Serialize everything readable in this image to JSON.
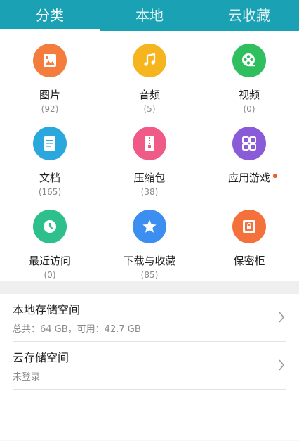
{
  "tabs": [
    {
      "label": "分类"
    },
    {
      "label": "本地"
    },
    {
      "label": "云收藏"
    }
  ],
  "colors": {
    "tabbar": "#1aa1b4",
    "image": "#f47c3c",
    "music": "#f6b51e",
    "video": "#2fbf5f",
    "document": "#2aa8de",
    "archive": "#ef5b86",
    "apps": "#8a5bd8",
    "recent": "#2dbf8c",
    "download": "#3c8ef0",
    "safe": "#f4713c"
  },
  "categories": [
    {
      "name": "图片",
      "count": "(92)",
      "icon": "image-icon"
    },
    {
      "name": "音频",
      "count": "(5)",
      "icon": "music-icon"
    },
    {
      "name": "视频",
      "count": "(0)",
      "icon": "video-icon"
    },
    {
      "name": "文档",
      "count": "(165)",
      "icon": "document-icon"
    },
    {
      "name": "压缩包",
      "count": "(38)",
      "icon": "archive-icon"
    },
    {
      "name": "应用游戏",
      "count": "",
      "icon": "apps-icon"
    },
    {
      "name": "最近访问",
      "count": "(0)",
      "icon": "clock-icon"
    },
    {
      "name": "下载与收藏",
      "count": "(85)",
      "icon": "star-icon"
    },
    {
      "name": "保密柜",
      "count": "",
      "icon": "safe-icon"
    }
  ],
  "storage": {
    "local_title": "本地存储空间",
    "local_sub": "总共：64 GB，可用：42.7 GB",
    "cloud_title": "云存储空间",
    "cloud_sub": "未登录"
  }
}
